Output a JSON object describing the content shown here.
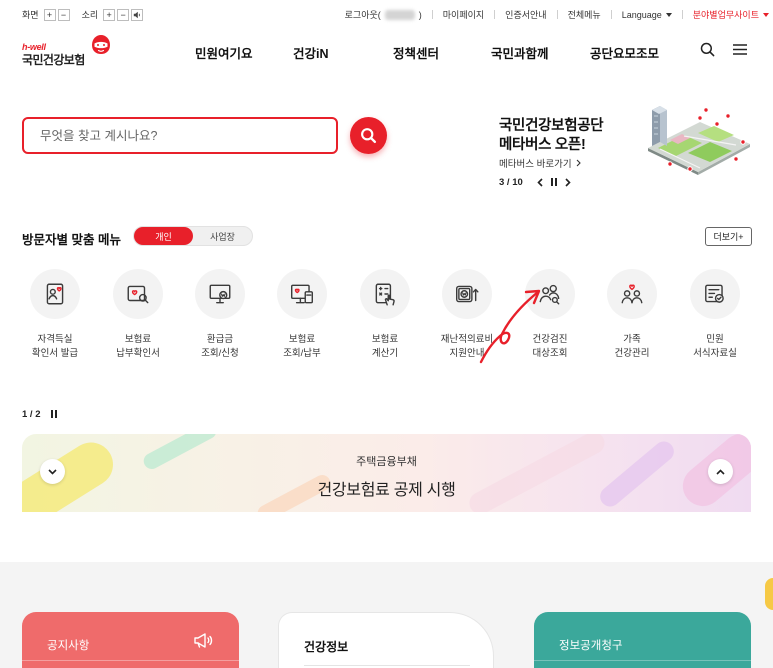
{
  "utility": {
    "screen_label": "화면",
    "sound_label": "소리",
    "plus": "+",
    "minus": "−",
    "logout_prefix": "로그아웃(",
    "logout_suffix": ")",
    "mypage": "마이페이지",
    "certificate": "인증서안내",
    "all_menu": "전체메뉴",
    "language": "Language",
    "field_sites": "분야별업무사이트"
  },
  "logo": {
    "tagline": "h-well",
    "name": "국민건강보험"
  },
  "nav": [
    {
      "label": "민원여기요"
    },
    {
      "label": "건강iN"
    },
    {
      "label": "정책센터"
    },
    {
      "label": "국민과함께"
    },
    {
      "label": "공단요모조모"
    }
  ],
  "search": {
    "placeholder": "무엇을 찾고 계시나요?"
  },
  "promo": {
    "line1": "국민건강보험공단",
    "line2": "메타버스 오픈!",
    "link": "메타버스 바로가기",
    "pager": "3 / 10"
  },
  "custom_menu": {
    "title": "방문자별 맞춤 메뉴",
    "tabs": [
      {
        "label": "개인",
        "active": true
      },
      {
        "label": "사업장",
        "active": false
      }
    ],
    "more": "더보기+",
    "items": [
      {
        "line1": "자격득실",
        "line2": "확인서 발급",
        "icon": "certificate-icon"
      },
      {
        "line1": "보험료",
        "line2": "납부확인서",
        "icon": "document-search-icon"
      },
      {
        "line1": "환급금",
        "line2": "조회/신청",
        "icon": "monitor-refund-icon"
      },
      {
        "line1": "보험료",
        "line2": "조회/납부",
        "icon": "payment-device-icon"
      },
      {
        "line1": "보험료",
        "line2": "계산기",
        "icon": "calculator-icon"
      },
      {
        "line1": "재난적의료비",
        "line2": "지원안내",
        "icon": "medical-support-icon"
      },
      {
        "line1": "건강검진",
        "line2": "대상조회",
        "icon": "person-search-icon"
      },
      {
        "line1": "가족",
        "line2": "건강관리",
        "icon": "family-icon"
      },
      {
        "line1": "민원",
        "line2": "서식자료실",
        "icon": "form-check-icon"
      }
    ],
    "pager": "1 / 2"
  },
  "banner": {
    "subtitle": "주택금융부채",
    "title": "건강보험료 공제 시행"
  },
  "cards": [
    {
      "title": "공지사항",
      "color": "#ef6b6b"
    },
    {
      "title": "건강정보",
      "color": "#ffffff"
    },
    {
      "title": "정보공개청구",
      "color": "#3ba89b"
    }
  ],
  "colors": {
    "accent": "#e8202a",
    "icon_bg": "#f3f3f3",
    "section_bg": "#f4f4f4",
    "highlight": "#f6c945"
  }
}
